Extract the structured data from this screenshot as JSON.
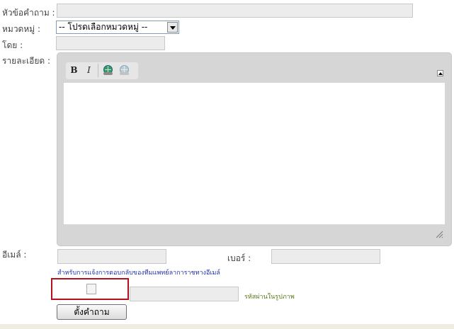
{
  "form": {
    "title_label": "หัวข้อคำถาม :",
    "title_value": "",
    "category_label": "หมวดหมู่ :",
    "category_selected": "-- โปรดเลือกหมวดหมู่ --",
    "author_label": "โดย :",
    "author_value": "",
    "detail_label": "รายละเอียด :",
    "email_label": "อีเมล์ :",
    "email_value": "",
    "phone_label": "เบอร์ :",
    "phone_value": "",
    "email_note": "สำหรับการแจ้งการตอบกลับของทีมแพทย์ลาการาชทางอีเมล์",
    "captcha_value": "",
    "captcha_note": "รหัสผ่านในรูปภาพ",
    "submit_label": "ตั้งคำถาม"
  },
  "editor": {
    "bold_label": "B",
    "italic_label": "I",
    "link_icon": "link-icon",
    "unlink_icon": "unlink-icon",
    "collapse_icon": "collapse-icon",
    "resize_icon": "resize-grip-icon",
    "content": ""
  }
}
